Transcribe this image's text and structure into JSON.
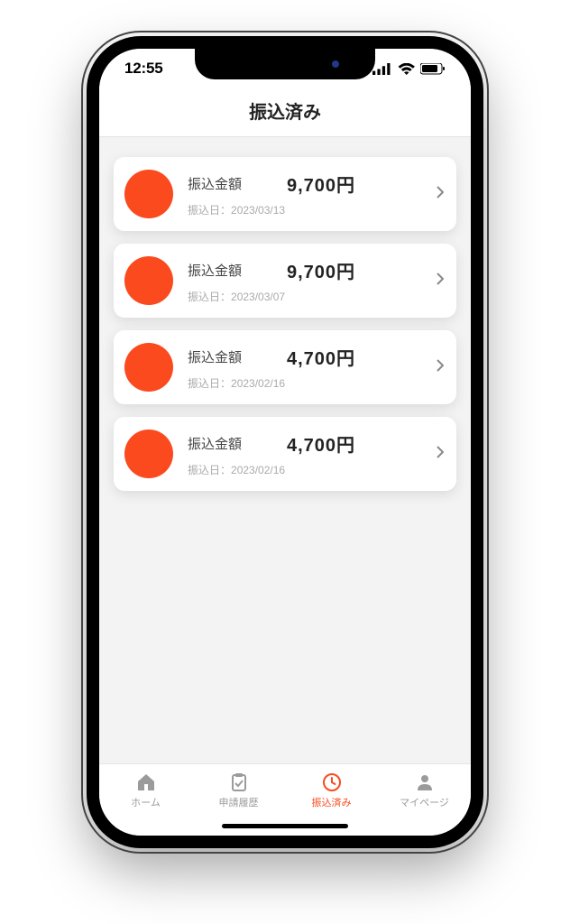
{
  "status": {
    "time": "12:55"
  },
  "header": {
    "title": "振込済み"
  },
  "labels": {
    "amount_label": "振込金額",
    "date_prefix": "振込日："
  },
  "transfers": [
    {
      "amount": "9,700円",
      "date": "2023/03/13"
    },
    {
      "amount": "9,700円",
      "date": "2023/03/07"
    },
    {
      "amount": "4,700円",
      "date": "2023/02/16"
    },
    {
      "amount": "4,700円",
      "date": "2023/02/16"
    }
  ],
  "tabs": {
    "home": "ホーム",
    "history": "申請履歴",
    "done": "振込済み",
    "mypage": "マイページ"
  },
  "colors": {
    "accent": "#fa4a1e"
  }
}
